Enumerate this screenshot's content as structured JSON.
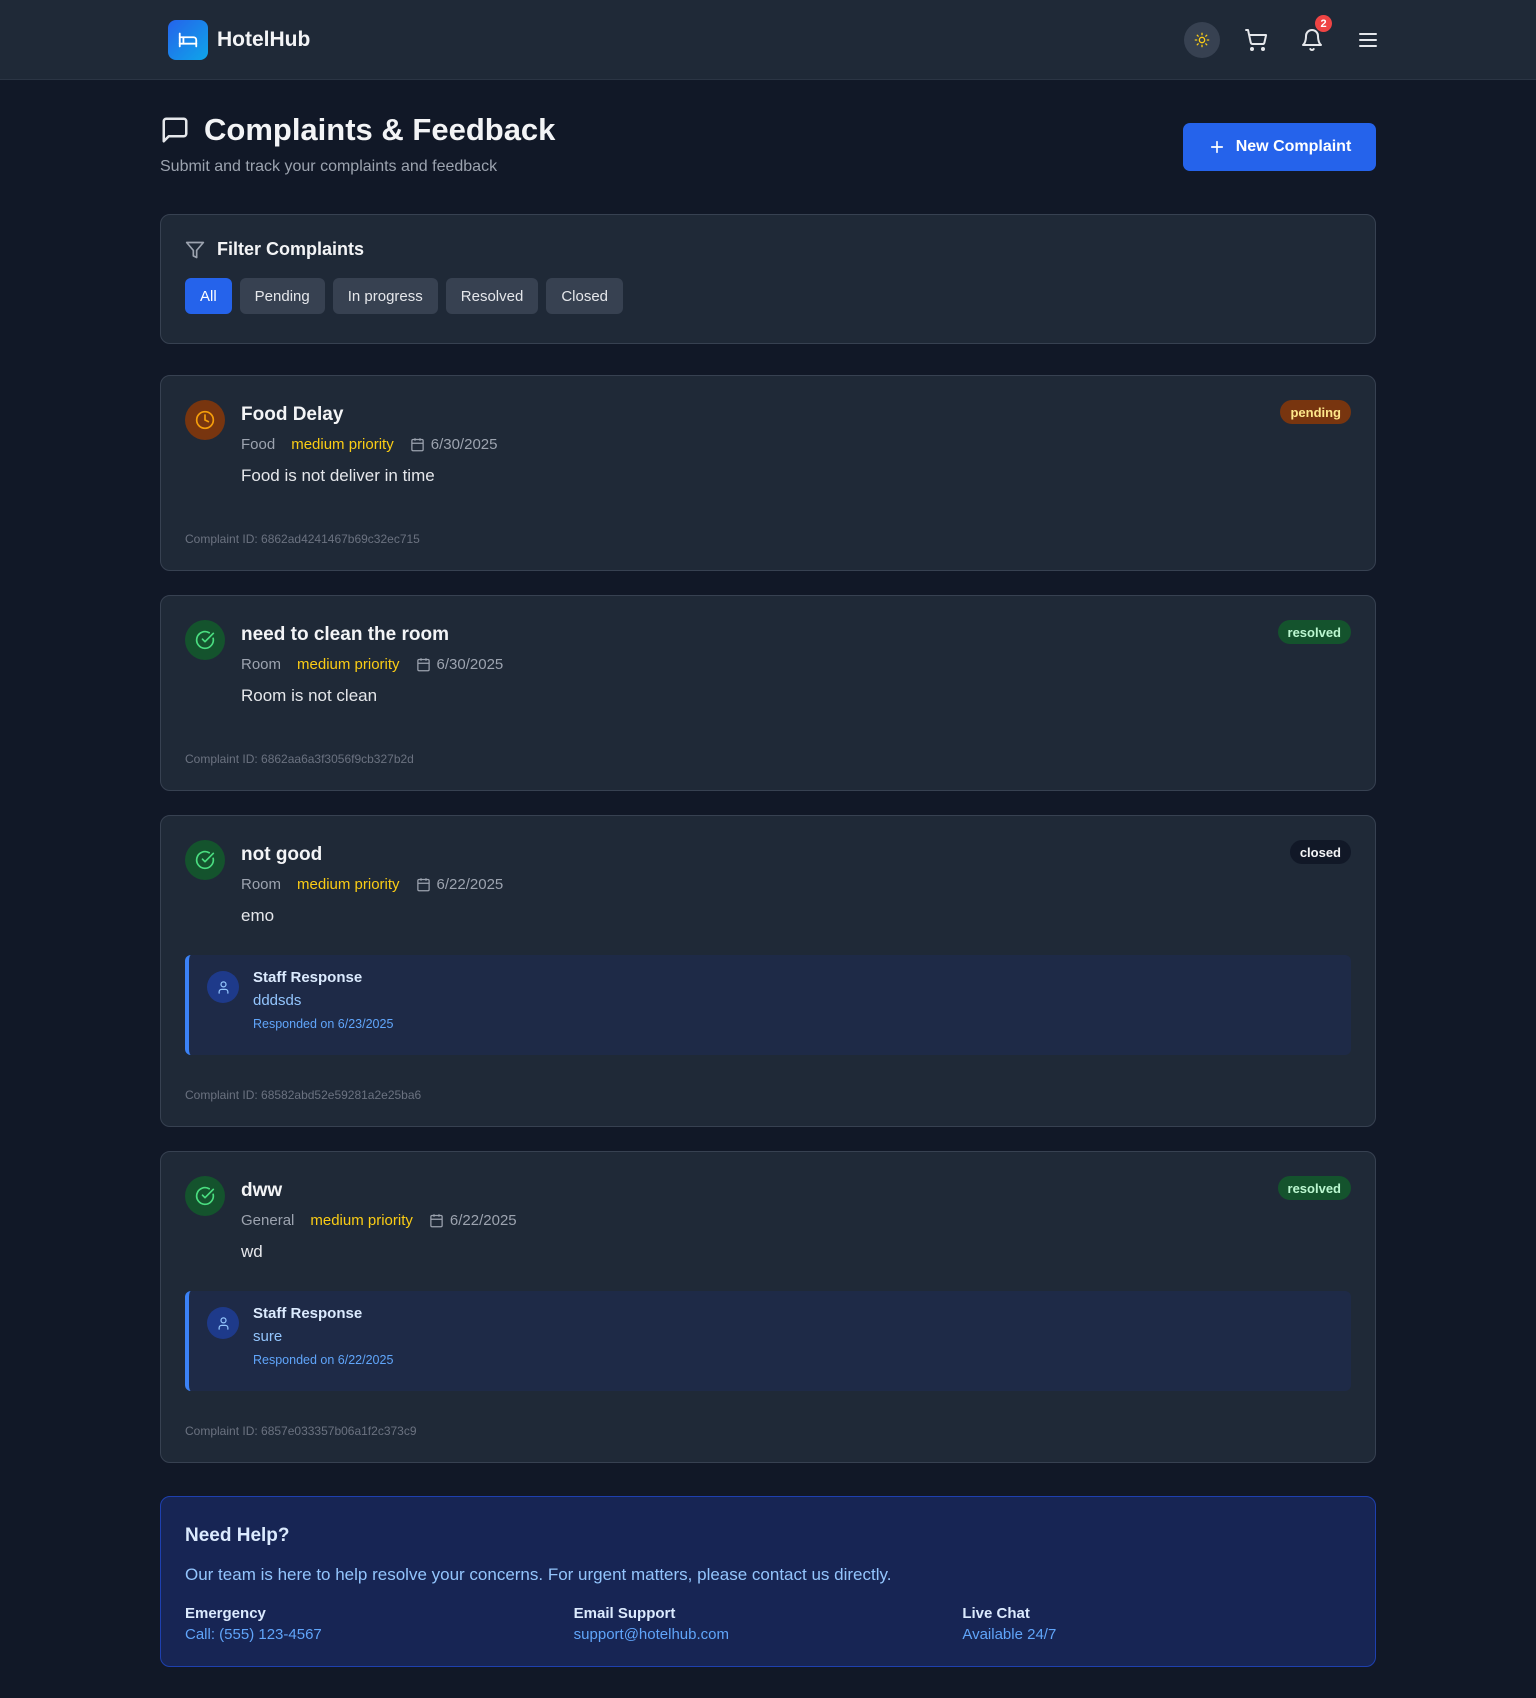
{
  "app": {
    "name": "HotelHub",
    "notification_count": "2"
  },
  "header": {
    "title": "Complaints & Feedback",
    "subtitle": "Submit and track your complaints and feedback",
    "new_button_label": "New Complaint"
  },
  "filter": {
    "title": "Filter Complaints",
    "options": [
      "All",
      "Pending",
      "In progress",
      "Resolved",
      "Closed"
    ],
    "selected": "All"
  },
  "complaints": [
    {
      "title": "Food Delay",
      "category": "Food",
      "priority": "medium priority",
      "date": "6/30/2025",
      "description": "Food is not deliver in time",
      "status": "pending",
      "id_label": "Complaint ID: 6862ad4241467b69c32ec715",
      "status_icon": "clock-icon"
    },
    {
      "title": "need to clean the room",
      "category": "Room",
      "priority": "medium priority",
      "date": "6/30/2025",
      "description": "Room is not clean",
      "status": "resolved",
      "id_label": "Complaint ID: 6862aa6a3f3056f9cb327b2d",
      "status_icon": "check-circle-icon"
    },
    {
      "title": "not good",
      "category": "Room",
      "priority": "medium priority",
      "date": "6/22/2025",
      "description": "emo",
      "status": "closed",
      "id_label": "Complaint ID: 68582abd52e59281a2e25ba6",
      "status_icon": "check-circle-icon",
      "response": {
        "label": "Staff Response",
        "text": "dddsds",
        "date": "Responded on 6/23/2025"
      }
    },
    {
      "title": "dww",
      "category": "General",
      "priority": "medium priority",
      "date": "6/22/2025",
      "description": "wd",
      "status": "resolved",
      "id_label": "Complaint ID: 6857e033357b06a1f2c373c9",
      "status_icon": "check-circle-icon",
      "response": {
        "label": "Staff Response",
        "text": "sure",
        "date": "Responded on 6/22/2025"
      }
    }
  ],
  "help": {
    "title": "Need Help?",
    "text": "Our team is here to help resolve your concerns. For urgent matters, please contact us directly.",
    "contacts": [
      {
        "label": "Emergency",
        "value": "Call: (555) 123-4567"
      },
      {
        "label": "Email Support",
        "value": "support@hotelhub.com"
      },
      {
        "label": "Live Chat",
        "value": "Available 24/7"
      }
    ]
  },
  "colors": {
    "background": "#111827",
    "card": "#1f2937",
    "accent": "#2563eb",
    "priority": "#facc15",
    "pending": "#78350f",
    "resolved": "#14532d"
  }
}
